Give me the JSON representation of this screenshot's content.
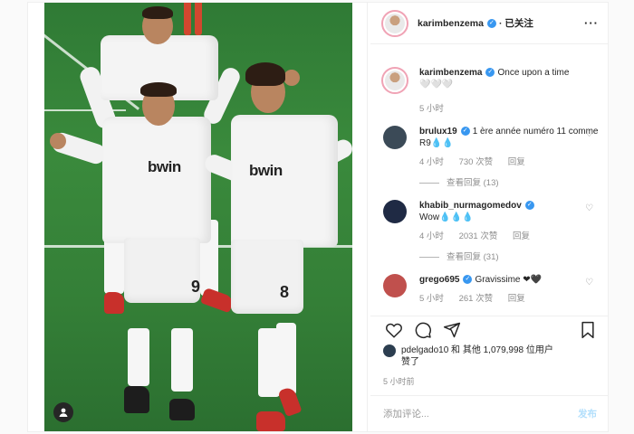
{
  "post": {
    "author": "karimbenzema",
    "follow_status": "· 已关注",
    "more_label": "···",
    "caption_text": "Once upon a time",
    "caption_emoji": "🤍🤍🤍",
    "caption_time": "5 小时",
    "photo": {
      "sponsor_left": "bwin",
      "sponsor_right": "bwin",
      "number_left": "9",
      "number_right": "8"
    }
  },
  "comments": [
    {
      "username": "brulux19",
      "text": "1 ère année numéro 11 comme R9💧💧",
      "time": "4 小时",
      "likes": "730 次赞",
      "reply_label": "回复",
      "view_replies": "查看回复 (13)",
      "avatar_color": "#3b4a57"
    },
    {
      "username": "khabib_nurmagomedov",
      "text": "Wow💧💧💧",
      "time": "4 小时",
      "likes": "2031 次赞",
      "reply_label": "回复",
      "view_replies": "查看回复 (31)",
      "avatar_color": "#1f2a44"
    },
    {
      "username": "grego695",
      "text": "Gravissime ❤🖤",
      "time": "5 小时",
      "likes": "261 次赞",
      "reply_label": "回复",
      "view_replies": "",
      "avatar_color": "#c0504d"
    }
  ],
  "likes_line": {
    "user": "pdelgado10",
    "rest": " 和 其他 1,079,998 位用户",
    "suffix": "赞了"
  },
  "timestamp": "5 小时前",
  "comment_box": {
    "placeholder": "添加评论...",
    "post_label": "发布"
  },
  "colors": {
    "verified": "#3897f0",
    "grass": "#3a8a3c",
    "post_button": "#b2dffc"
  }
}
